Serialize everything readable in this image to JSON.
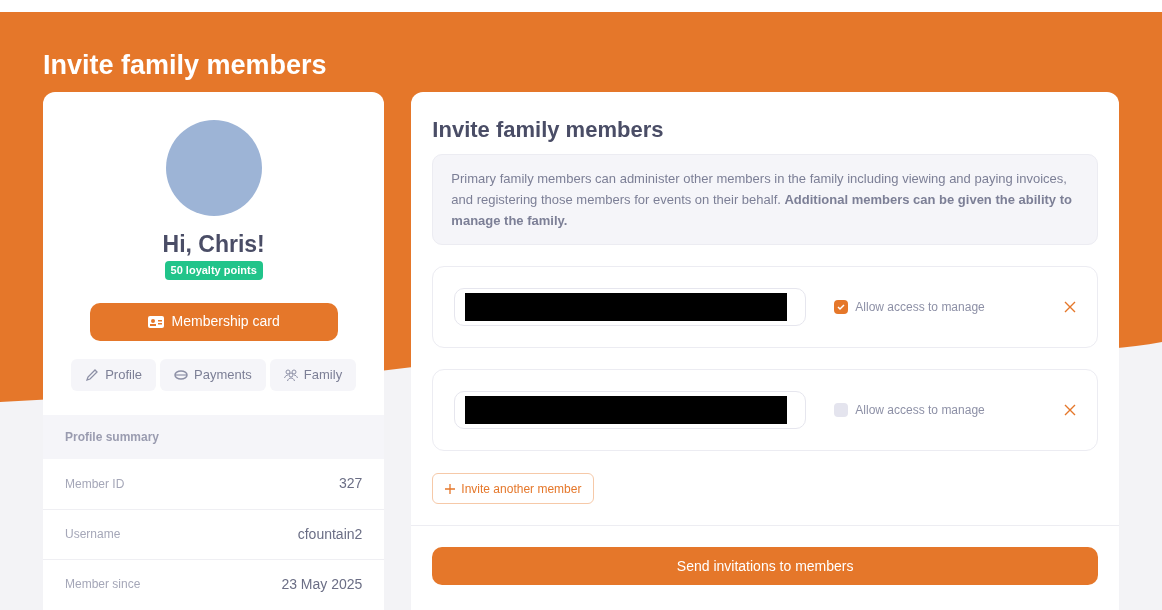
{
  "page_title": "Invite family members",
  "profile": {
    "greeting": "Hi, Chris!",
    "points": "50 loyalty points",
    "card_button": "Membership card",
    "tabs": [
      {
        "label": "Profile"
      },
      {
        "label": "Payments"
      },
      {
        "label": "Family"
      }
    ],
    "summary_title": "Profile summary",
    "fields": [
      {
        "label": "Member ID",
        "value": "327"
      },
      {
        "label": "Username",
        "value": "cfountain2"
      },
      {
        "label": "Member since",
        "value": "23 May 2025"
      }
    ]
  },
  "invite": {
    "title": "Invite family members",
    "info": "Primary family members can administer other members in the family including viewing and paying invoices, and registering those members for events on their behalf. **Additional members can be given the ability to manage the family.**",
    "members": [
      {
        "access_label": "Allow access to manage",
        "checked": true
      },
      {
        "access_label": "Allow access to manage",
        "checked": false
      }
    ],
    "add_button": "Invite another member",
    "send_button": "Send invitations to members"
  }
}
